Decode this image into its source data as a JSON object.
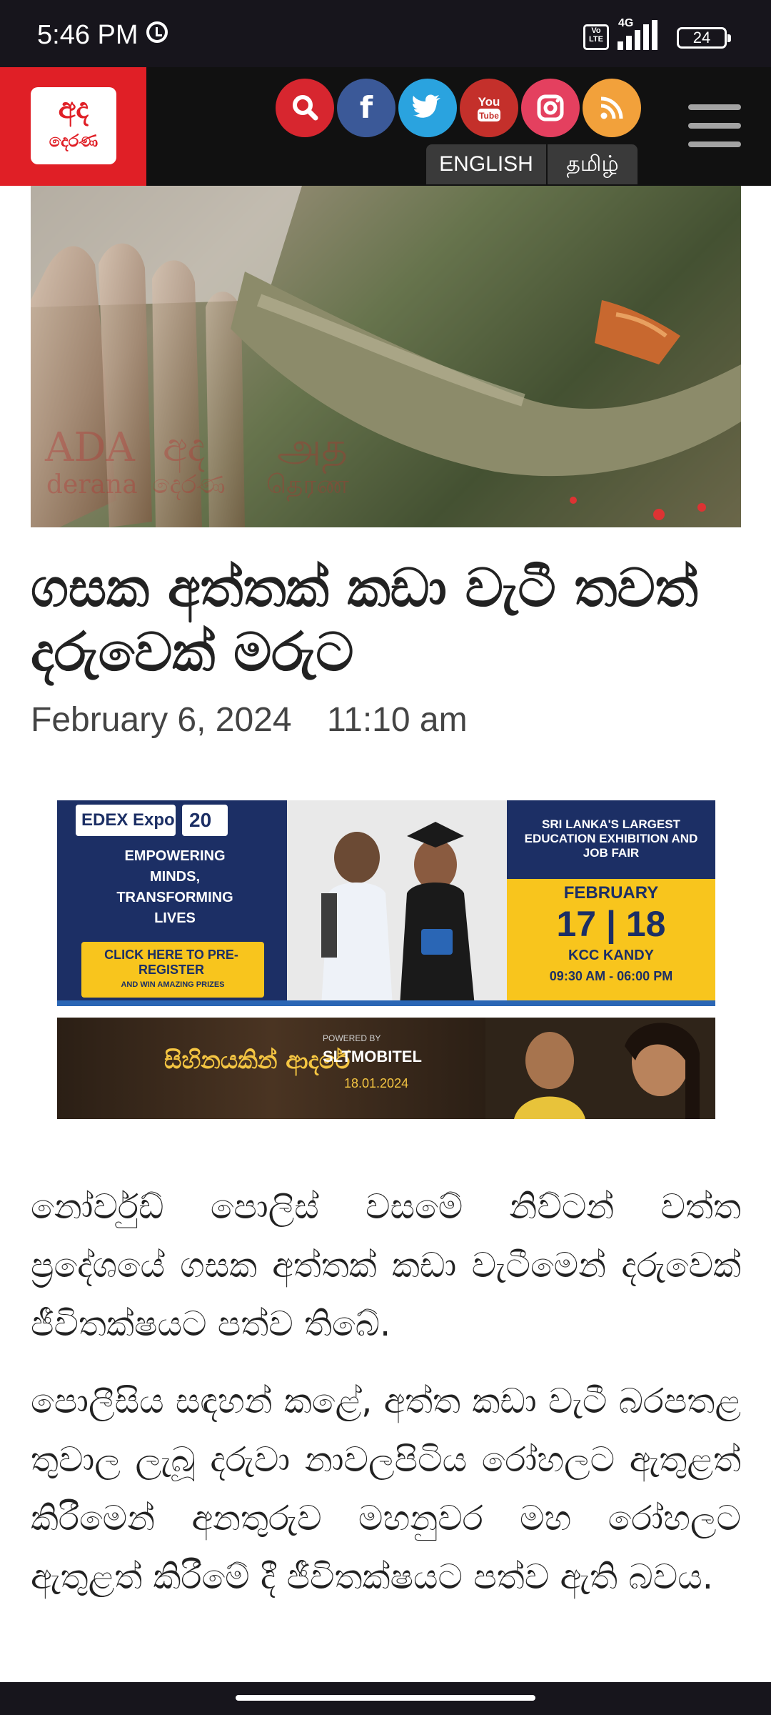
{
  "status_bar": {
    "time": "5:46 PM",
    "volte": "Vo LTE",
    "network": "4G",
    "battery": "24"
  },
  "header": {
    "logo_top": "අද",
    "logo_bottom": "දෙරණ",
    "languages": [
      "ENGLISH",
      "தமிழ்"
    ],
    "social": [
      "search-icon",
      "facebook-icon",
      "twitter-icon",
      "youtube-icon",
      "instagram-icon",
      "rss-icon"
    ],
    "social_colors": [
      "#d7262f",
      "#3b5998",
      "#2aa3df",
      "#c4302b",
      "#e4405f",
      "#f2a13b"
    ]
  },
  "hero_image": {
    "watermark": [
      "ADA derana",
      "අද දෙරණ",
      "அத தெரண"
    ]
  },
  "article": {
    "title": "ගසක අත්තක් කඩා වැටී තවත් දරුවෙක් මරුට",
    "date": "February 6, 2024",
    "time": "11:10 am",
    "paragraphs": [
      "නෝර්වුඩ් පොලිස් වසමේ නිව්ටන් වත්ත ප්‍රදේශයේ ගසක අත්තක් කඩා වැටීමෙන් දරුවෙක් ජීවිතක්ෂයට පත්ව තිබේ.",
      "පොලීසිය සඳහන් කළේ, අත්ත කඩා වැටී බරපතළ තුවාල ලැබූ දරුවා නාවලපිටිය රෝහලට ඇතුළත් කිරීමෙන් අනතුරුව මහනුවර මහ රෝහලට ඇතුළත් කිරීමේ දී ජීවිතක්ෂයට පත්ව ඇති බවය."
    ]
  },
  "ad_edex": {
    "brand": "EDEX Expo",
    "years": "20",
    "tagline": "EMPOWERING MINDS, TRANSFORMING LIVES",
    "cta": "CLICK HERE TO PRE-REGISTER",
    "cta_sub": "AND WIN AMAZING PRIZES",
    "headline": "SRI LANKA'S LARGEST EDUCATION EXHIBITION AND JOB FAIR",
    "month": "FEBRUARY",
    "dates": "17 | 18",
    "venue": "KCC KANDY",
    "hours": "09:30 AM - 06:00 PM"
  },
  "ad_teledrama": {
    "title": "සිහිනයකින් ආදරේ",
    "powered": "POWERED BY",
    "sponsor": "SLTMOBITEL",
    "date": "18.01.2024"
  }
}
